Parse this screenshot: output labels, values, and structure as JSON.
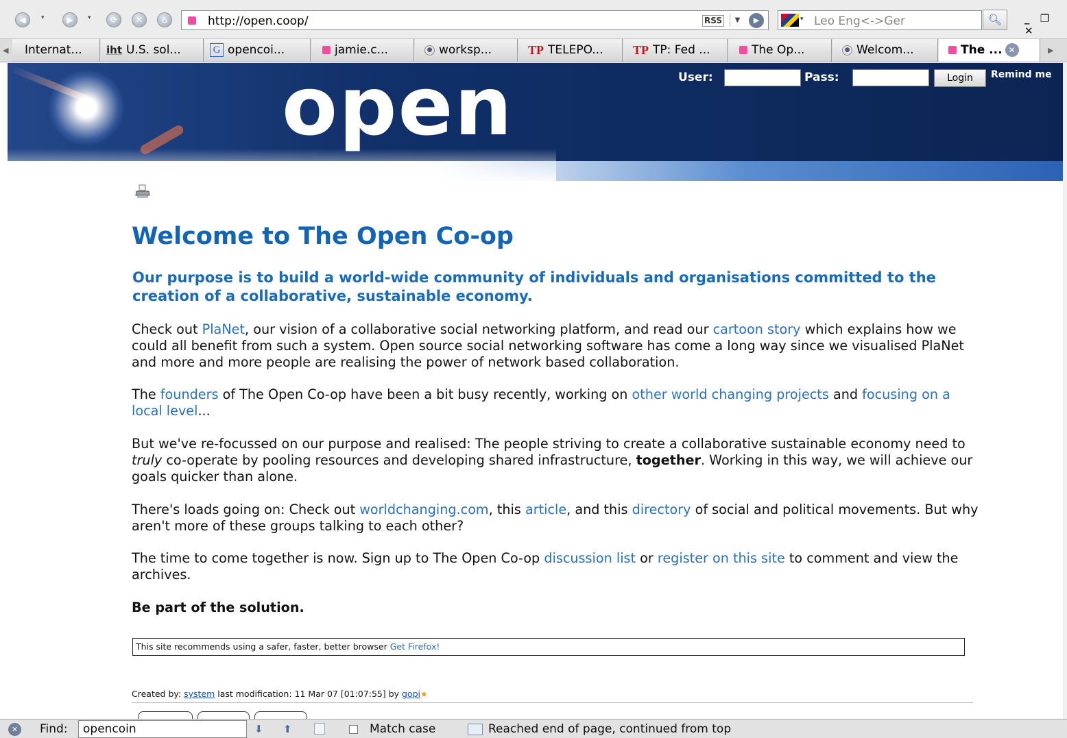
{
  "toolbar": {
    "url": "http://open.coop/",
    "rss_label": "RSS",
    "search_placeholder": "Leo Eng<->Ger"
  },
  "tabs": [
    {
      "label": "Internat...",
      "icon": "none"
    },
    {
      "label": "U.S. sol...",
      "icon": "iht-icon",
      "icon_text": "iht"
    },
    {
      "label": "opencoi...",
      "icon": "google-icon",
      "icon_text": "G"
    },
    {
      "label": "jamie.c...",
      "icon": "pink-square-icon"
    },
    {
      "label": "worksp...",
      "icon": "globe-icon"
    },
    {
      "label": "TELEPO...",
      "icon": "tp-icon",
      "icon_text": "TP"
    },
    {
      "label": "TP: Fed ...",
      "icon": "tp-icon",
      "icon_text": "TP"
    },
    {
      "label": "The Op...",
      "icon": "pink-square-icon"
    },
    {
      "label": "Welcom...",
      "icon": "globe-icon"
    },
    {
      "label": "The ...",
      "icon": "pink-square-icon",
      "active": true
    }
  ],
  "header": {
    "logo": "open",
    "user_label": "User:",
    "pass_label": "Pass:",
    "login_button": "Login",
    "remind_link": "Remind me"
  },
  "content": {
    "title": "Welcome to The Open Co-op",
    "purpose": "Our purpose is to build a world-wide community of individuals and organisations committed to the creation of a collaborative, sustainable economy.",
    "p1": {
      "t1": "Check out ",
      "l1": "PlaNet",
      "t2": ", our vision of a collaborative social networking platform, and read our ",
      "l2": "cartoon story",
      "t3": " which explains how we could all benefit from such a system. Open source social networking software has come a long way since we visualised PlaNet and more and more people are realising the power of network based collaboration."
    },
    "p2": {
      "t1": "The ",
      "l1": "founders",
      "t2": " of The Open Co-op have been a bit busy recently, working on ",
      "l2": "other world changing projects",
      "t3": " and ",
      "l3": "focusing on a local level",
      "t4": "..."
    },
    "p3": {
      "t1": "But we've re-focussed on our purpose and realised: The people striving to create a collaborative sustainable economy need to ",
      "em": "truly",
      "t2": " co-operate by pooling resources and developing shared infrastructure, ",
      "strong": "together",
      "t3": ". Working in this way, we will achieve our goals quicker than alone."
    },
    "p4": {
      "t1": "There's loads going on: Check out ",
      "l1": "worldchanging.com",
      "t2": ", this ",
      "l2": "article",
      "t3": ", and this ",
      "l3": "directory",
      "t4": " of social and political movements. But why aren't more of these groups talking to each other?"
    },
    "p5": {
      "t1": "The time to come together is now. Sign up to The Open Co-op ",
      "l1": "discussion list",
      "t2": " or ",
      "l2": "register on this site",
      "t3": " to comment and view the archives."
    },
    "solution": "Be part of the solution.",
    "browser_note": {
      "text": "This site recommends using a safer, faster, better browser ",
      "link": "Get Firefox!"
    },
    "created": {
      "t1": "Created by: ",
      "user": "system",
      "t2": " last modification: 11 Mar 07 [01:07:55] by ",
      "by": "gopi"
    }
  },
  "findbar": {
    "label": "Find:",
    "query": "opencoin",
    "match_case": "Match case",
    "status": "Reached end of page, continued from top"
  }
}
